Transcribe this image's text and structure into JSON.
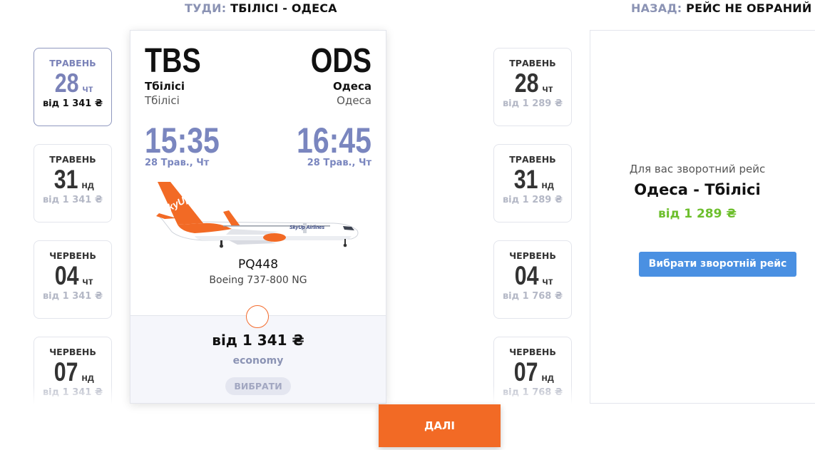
{
  "header": {
    "outbound_key": "ТУДИ:",
    "outbound_value": "ТБІЛІСІ - ОДЕСА",
    "return_key": "НАЗАД:",
    "return_value": "РЕЙС НЕ ОБРАНИЙ"
  },
  "outbound_dates": [
    {
      "month": "ТРАВЕНЬ",
      "day": "28",
      "weekday": "чт",
      "price": "від 1 341 ₴",
      "selected": true
    },
    {
      "month": "ТРАВЕНЬ",
      "day": "31",
      "weekday": "нд",
      "price": "від 1 341 ₴",
      "selected": false
    },
    {
      "month": "ЧЕРВЕНЬ",
      "day": "04",
      "weekday": "чт",
      "price": "від 1 341 ₴",
      "selected": false
    },
    {
      "month": "ЧЕРВЕНЬ",
      "day": "07",
      "weekday": "нд",
      "price": "від 1 341 ₴",
      "selected": false
    }
  ],
  "return_dates": [
    {
      "month": "ТРАВЕНЬ",
      "day": "28",
      "weekday": "чт",
      "price": "від 1 289 ₴"
    },
    {
      "month": "ТРАВЕНЬ",
      "day": "31",
      "weekday": "нд",
      "price": "від 1 289 ₴"
    },
    {
      "month": "ЧЕРВЕНЬ",
      "day": "04",
      "weekday": "чт",
      "price": "від 1 768 ₴"
    },
    {
      "month": "ЧЕРВЕНЬ",
      "day": "07",
      "weekday": "нд",
      "price": "від 1 768 ₴"
    }
  ],
  "flight": {
    "from_code": "TBS",
    "from_city": "Тбілісі",
    "from_city_sub": "Тбілісі",
    "to_code": "ODS",
    "to_city": "Одеса",
    "to_city_sub": "Одеса",
    "dep_time": "15:35",
    "dep_date": "28 Трав., Чт",
    "arr_time": "16:45",
    "arr_date": "28 Трав., Чт",
    "flight_no": "PQ448",
    "aircraft": "Boeing 737-800 NG",
    "airline_logo_text": "SkyUp Airlines",
    "tail_logo_text": "SkyUp",
    "price": "від 1 341 ₴",
    "fare_class": "economy",
    "choose_label": "ВИБРАТИ"
  },
  "return_panel": {
    "subtitle": "Для вас зворотний рейс",
    "route": "Одеса - Тбілісі",
    "price": "від 1 289 ₴",
    "button": "Вибрати зворотній рейс"
  },
  "next_label": "ДАЛІ",
  "colors": {
    "accent_orange": "#f26a25",
    "accent_blue": "#4a90e2",
    "time_blue": "#7a86bf",
    "price_green": "#6dbf2d"
  }
}
